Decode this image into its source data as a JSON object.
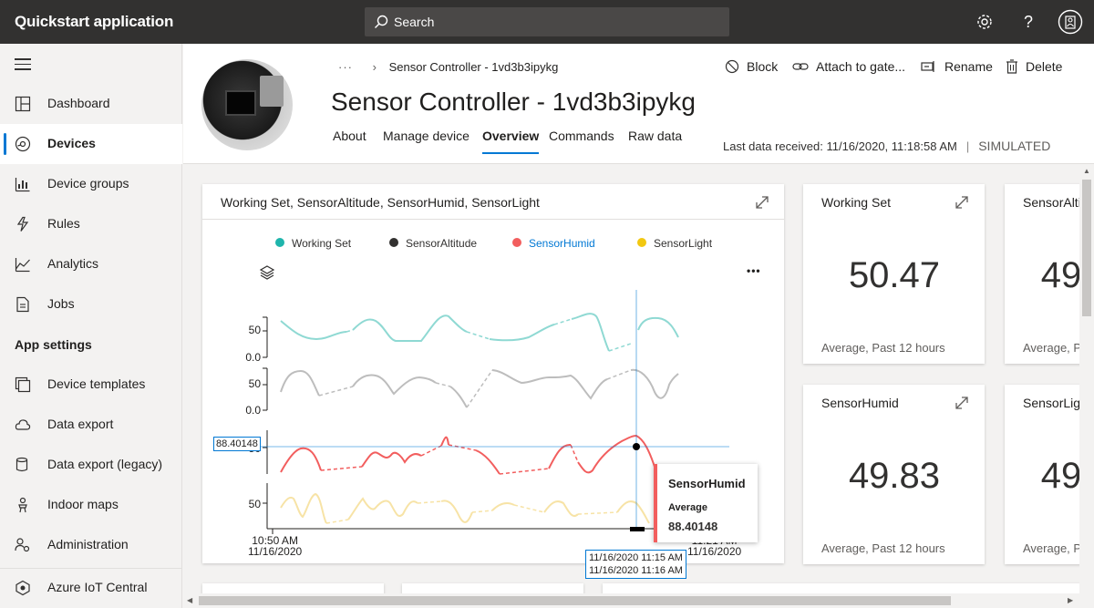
{
  "app": {
    "title": "Quickstart application"
  },
  "search": {
    "label": "Search"
  },
  "topbar_icons": [
    "gear-icon",
    "help-icon",
    "user-avatar-icon"
  ],
  "sidebar": {
    "items": [
      {
        "label": "Dashboard",
        "icon": "dashboard-icon",
        "active": false
      },
      {
        "label": "Devices",
        "icon": "devices-icon",
        "active": true
      },
      {
        "label": "Device groups",
        "icon": "device-groups-icon",
        "active": false
      },
      {
        "label": "Rules",
        "icon": "rules-icon",
        "active": false
      },
      {
        "label": "Analytics",
        "icon": "analytics-icon",
        "active": false
      },
      {
        "label": "Jobs",
        "icon": "jobs-icon",
        "active": false
      }
    ],
    "section_label": "App settings",
    "settings_items": [
      {
        "label": "Device templates",
        "icon": "device-templates-icon"
      },
      {
        "label": "Data export",
        "icon": "data-export-icon"
      },
      {
        "label": "Data export (legacy)",
        "icon": "data-export-legacy-icon"
      },
      {
        "label": "Indoor maps",
        "icon": "indoor-maps-icon"
      },
      {
        "label": "Administration",
        "icon": "administration-icon"
      }
    ],
    "footer_item": {
      "label": "Azure IoT Central",
      "icon": "azure-iot-central-icon"
    }
  },
  "header": {
    "breadcrumb_dots": "···",
    "breadcrumb_current": "Sensor Controller - 1vd3b3ipykg",
    "title": "Sensor Controller - 1vd3b3ipykg",
    "tabs": [
      "About",
      "Manage device",
      "Overview",
      "Commands",
      "Raw data"
    ],
    "active_tab": "Overview",
    "commands": [
      {
        "label": "Block",
        "icon": "block-icon"
      },
      {
        "label": "Attach to gate...",
        "icon": "attach-gateway-icon"
      },
      {
        "label": "Rename",
        "icon": "rename-icon"
      },
      {
        "label": "Delete",
        "icon": "delete-icon"
      }
    ],
    "last_data_received": "Last data received: 11/16/2020, 11:18:58 AM",
    "separator": "|",
    "status": "SIMULATED"
  },
  "chart_card": {
    "title": "Working Set, SensorAltitude, SensorHumid, SensorLight",
    "legend": [
      {
        "name": "Working Set",
        "color": "#1fb5ac"
      },
      {
        "name": "SensorAltitude",
        "color": "#323130"
      },
      {
        "name": "SensorHumid",
        "color": "#f25e5e",
        "highlighted": true
      },
      {
        "name": "SensorLight",
        "color": "#f2c811"
      }
    ],
    "more_label": "•••",
    "hover_value": "88.40148",
    "tooltip": {
      "series": "SensorHumid",
      "stat_label": "Average",
      "value": "88.40148"
    },
    "cursor_range": [
      "11/16/2020 11:15 AM",
      "11/16/2020 11:16 AM"
    ],
    "x_labels": [
      {
        "time": "10:50 AM",
        "date": "11/16/2020"
      },
      {
        "time": "11:21 AM",
        "date": "11/16/2020"
      }
    ]
  },
  "chart_data": {
    "type": "line",
    "x_range": [
      "11/16/2020 10:50 AM",
      "11/16/2020 11:21 AM"
    ],
    "series": [
      {
        "name": "Working Set",
        "color": "#8fd9d3",
        "y_ticks": [
          "50",
          "0.0"
        ]
      },
      {
        "name": "SensorAltitude",
        "color": "#bdbdbd",
        "y_ticks": [
          "50",
          "0.0"
        ]
      },
      {
        "name": "SensorHumid",
        "color": "#f25e5e",
        "y_ticks": [
          "50"
        ]
      },
      {
        "name": "SensorLight",
        "color": "#f7e3a6",
        "y_ticks": [
          "50"
        ]
      }
    ]
  },
  "kpis": [
    {
      "title": "Working Set",
      "value": "50.47",
      "subtitle": "Average, Past 12 hours"
    },
    {
      "title": "SensorAlti",
      "value": "49",
      "subtitle": "Average, P"
    },
    {
      "title": "SensorHumid",
      "value": "49.83",
      "subtitle": "Average, Past 12 hours"
    },
    {
      "title": "SensorLig",
      "value": "49",
      "subtitle": "Average, P"
    }
  ]
}
